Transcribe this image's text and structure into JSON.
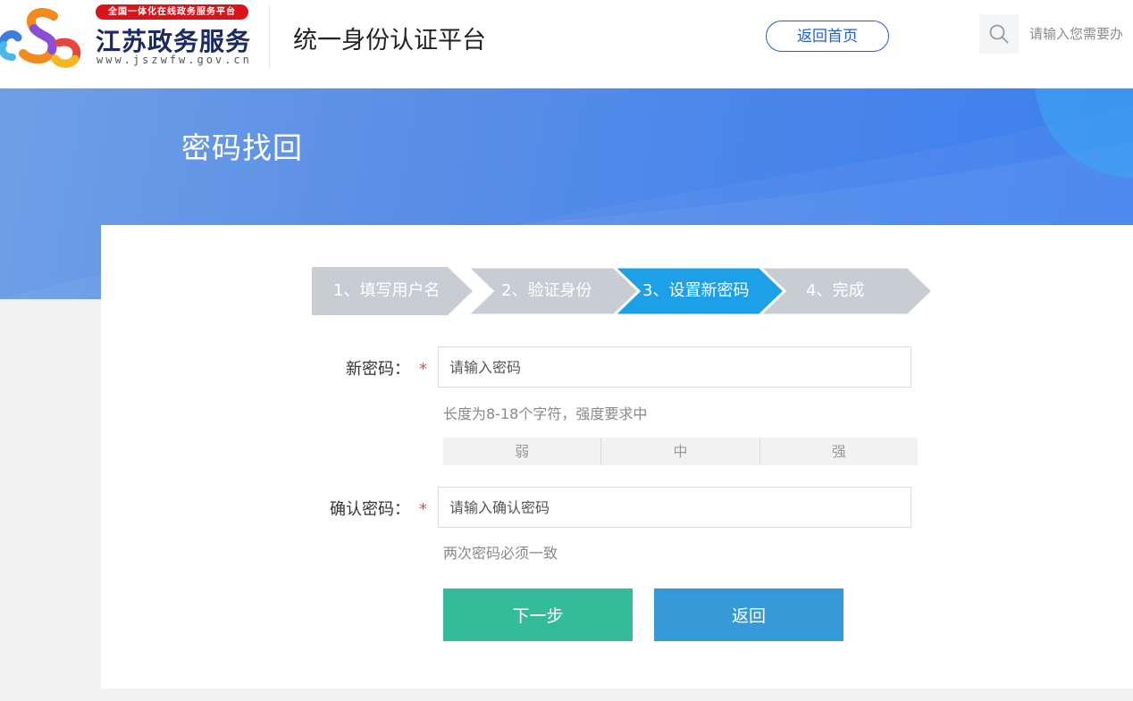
{
  "header": {
    "logo_badge": "全国一体化在线政务服务平台",
    "logo_name": "江苏政务服务",
    "logo_url": "www.jszwfw.gov.cn",
    "platform_title": "统一身份认证平台",
    "home_button": "返回首页",
    "search_placeholder": "请输入您需要办"
  },
  "banner": {
    "title": "密码找回"
  },
  "steps": [
    {
      "label": "1、填写用户名",
      "active": false
    },
    {
      "label": "2、验证身份",
      "active": false
    },
    {
      "label": "3、设置新密码",
      "active": true
    },
    {
      "label": "4、完成",
      "active": false
    }
  ],
  "form": {
    "new_password": {
      "label": "新密码：",
      "required": "*",
      "placeholder": "请输入密码",
      "hint": "长度为8-18个字符，强度要求中"
    },
    "strength": {
      "weak": "弱",
      "medium": "中",
      "strong": "强"
    },
    "confirm_password": {
      "label": "确认密码：",
      "required": "*",
      "placeholder": "请输入确认密码",
      "hint": "两次密码必须一致"
    }
  },
  "buttons": {
    "next": "下一步",
    "back": "返回"
  },
  "colors": {
    "step_active": "#1ea0e8",
    "step_inactive": "#c8cdd3",
    "next_button": "#33bb9a",
    "back_button": "#3699d8",
    "required": "#e34b4b"
  }
}
